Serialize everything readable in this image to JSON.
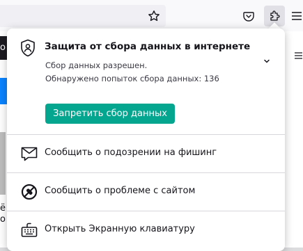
{
  "toolbar": {
    "bookmark_icon": "star-outline-icon",
    "pocket_icon": "pocket-icon",
    "extensions_icon": "puzzle-piece-icon",
    "menu_icon": "hamburger-menu-icon"
  },
  "page_fragments": {
    "left_dark_letter": "о",
    "left_text": "ё\nо"
  },
  "panel": {
    "header": {
      "icon": "shield-icon",
      "title": "Защита от сбора данных в интернете",
      "status_line1": "Сбор данных разрешен.",
      "status_line2": "Обнаружено попыток сбора данных: 136",
      "expand_icon": "chevron-down-icon",
      "action_label": "Запретить сбор данных",
      "action_color": "#04a68f"
    },
    "items": [
      {
        "icon": "phishing-mail-icon",
        "label": "Сообщить о подозрении на фишинг"
      },
      {
        "icon": "broken-site-icon",
        "label": "Сообщить о проблеме с сайтом"
      },
      {
        "icon": "keyboard-icon",
        "label": "Открыть Экранную клавиатуру"
      }
    ]
  }
}
